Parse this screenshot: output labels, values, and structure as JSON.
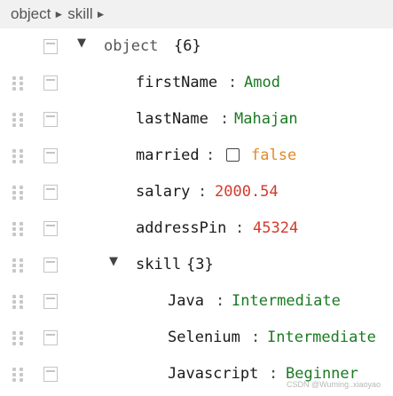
{
  "breadcrumb": {
    "items": [
      "object",
      "skill"
    ],
    "arrow": "►"
  },
  "tree": {
    "root": {
      "key": "object",
      "count": "{6}"
    },
    "separator": ":",
    "fields": {
      "firstName": {
        "key": "firstName",
        "value": "Amod"
      },
      "lastName": {
        "key": "lastName",
        "value": "Mahajan"
      },
      "married": {
        "key": "married",
        "value": "false"
      },
      "salary": {
        "key": "salary",
        "value": "2000.54"
      },
      "addressPin": {
        "key": "addressPin",
        "value": "45324"
      }
    },
    "skill": {
      "key": "skill",
      "count": "{3}",
      "items": {
        "java": {
          "key": "Java",
          "value": "Intermediate"
        },
        "selenium": {
          "key": "Selenium",
          "value": "Intermediate"
        },
        "javascript": {
          "key": "Javascript",
          "value": "Beginner"
        }
      }
    },
    "toggle_icon": "▼"
  },
  "colors": {
    "string": "#1b7a23",
    "number": "#d33a2c",
    "boolean": "#e08a2a",
    "toolbar": "#f1f1f1"
  },
  "watermark": "CSDN @Wuming..xiaoyao"
}
